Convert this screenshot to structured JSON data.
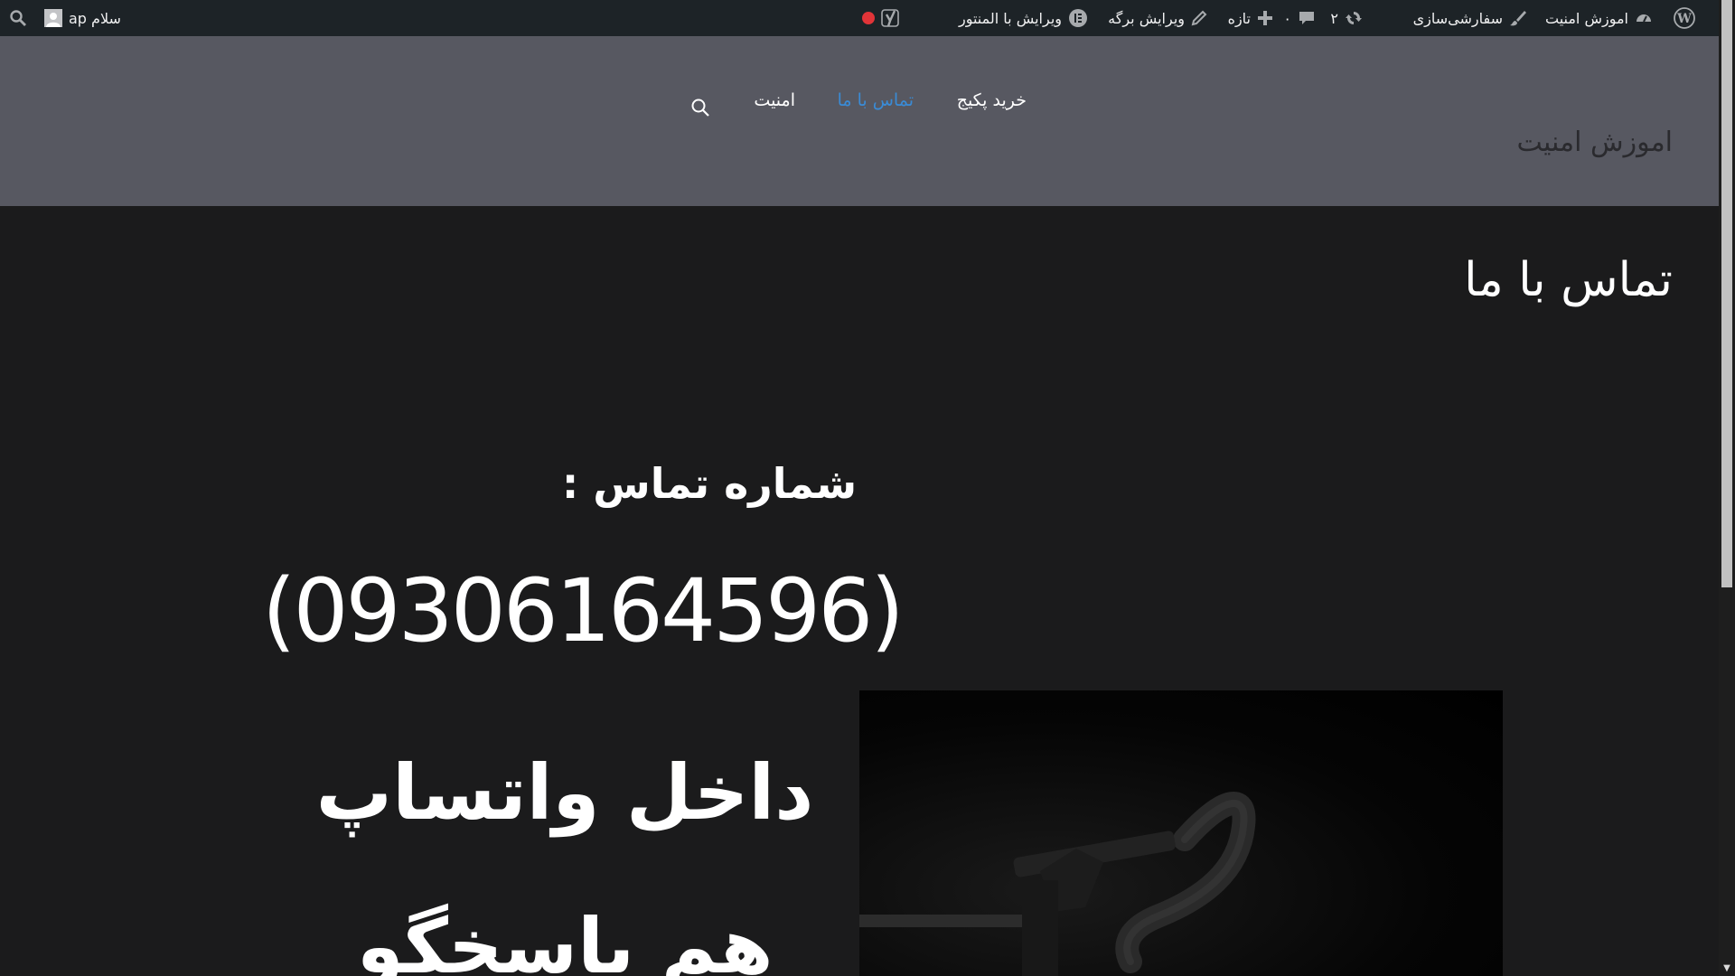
{
  "adminbar": {
    "site_name": "اموزش امنیت",
    "customize": "سفارشی‌سازی",
    "updates_count": "۲",
    "comments_count": "۰",
    "new_label": "تازه",
    "edit_page": "ویرایش برگه",
    "edit_elementor": "ویرایش با المنتور",
    "greeting": "سلام ap",
    "status_dot_color": "#e13438"
  },
  "nav": {
    "items": [
      {
        "label": "خرید پکیج"
      },
      {
        "label": "تماس با ما",
        "active": true
      },
      {
        "label": "امنیت"
      }
    ]
  },
  "site": {
    "title": "اموزش امنیت"
  },
  "page": {
    "title": "تماس با ما",
    "contact_heading": "شماره تماس :",
    "phone": "(09306164596)",
    "whatsapp_line1": "داخل واتساپ",
    "whatsapp_line2": "هم پاسخگو"
  },
  "colors": {
    "adminbar_bg": "#1d2327",
    "header_bg": "#575861",
    "content_bg": "#1b1b1c",
    "nav_active": "#3a8bd6"
  }
}
